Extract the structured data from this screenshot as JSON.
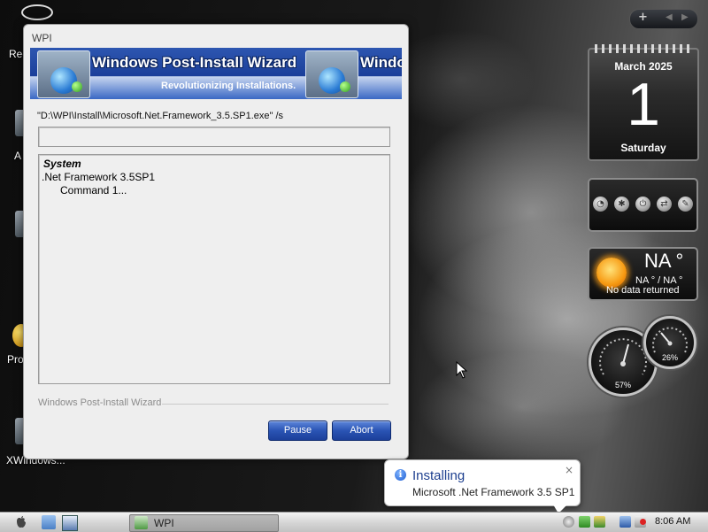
{
  "desktop": {
    "icon_labels": [
      "Rec",
      "A",
      "Pro",
      "XWindows..."
    ]
  },
  "wpi": {
    "window_title": "WPI",
    "banner_title": "Windows Post-Install Wizard",
    "banner_title_clip": "Windo",
    "banner_tagline": "Revolutionizing Installations.",
    "command_line": "\"D:\\WPI\\Install\\Microsoft.Net.Framework_3.5.SP1.exe\" /s",
    "progress_fraction": 0,
    "log": {
      "section": "System",
      "item": ".Net Framework 3.5SP1",
      "command": "Command 1..."
    },
    "footer_label": "Windows Post-Install Wizard",
    "pause_label": "Pause",
    "abort_label": "Abort"
  },
  "gadgets": {
    "calendar": {
      "month_year": "March 2025",
      "day": "1",
      "weekday": "Saturday"
    },
    "weather": {
      "temp": "NA °",
      "range": "NA ° / NA °",
      "status": "No data returned"
    },
    "gauges": [
      {
        "value": "57%"
      },
      {
        "value": "26%"
      }
    ],
    "top_bar": {
      "add": "+",
      "prev": "◀",
      "next": "▶"
    }
  },
  "notification": {
    "title": "Installing",
    "text": "Microsoft .Net Framework 3.5 SP1",
    "close": "×"
  },
  "taskbar": {
    "task_label": "WPI",
    "clock": "8:06 AM"
  },
  "colors": {
    "button_blue": "#2a54b4",
    "balloon_title": "#1d3f8f"
  }
}
